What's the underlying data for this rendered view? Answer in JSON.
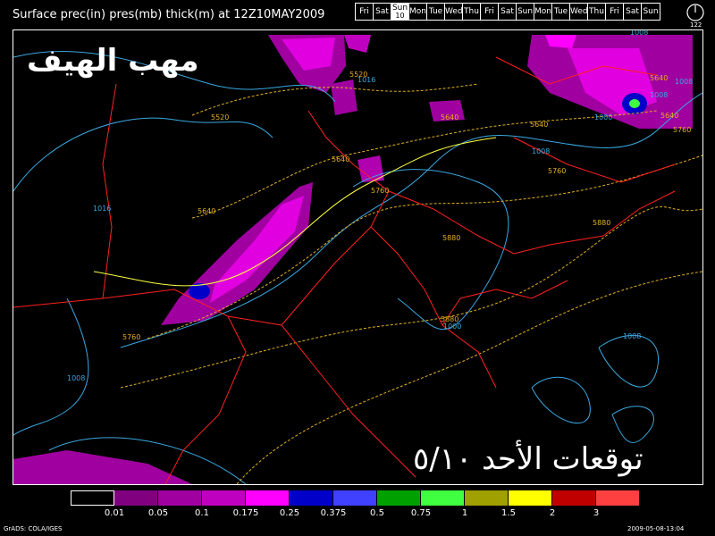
{
  "header": {
    "title": "Surface prec(in) pres(mb) thick(m) at 12Z10MAY2009"
  },
  "daybar": {
    "days": [
      "Fri",
      "Sat",
      "Sun",
      "Mon",
      "Tue",
      "Wed",
      "Thu",
      "Fri",
      "Sat",
      "Sun",
      "Mon",
      "Tue",
      "Wed",
      "Thu",
      "Fri",
      "Sat",
      "Sun"
    ],
    "selected_index": 2,
    "selected_sub": "10",
    "clock_label": "122"
  },
  "overlay": {
    "top_text": "مهب الهيف",
    "bottom_text": "توقعات الأحد ٥/١٠"
  },
  "contour_labels": {
    "thickness": [
      "5520",
      "5520",
      "5640",
      "5640",
      "5640",
      "5640",
      "5640",
      "5760",
      "5760",
      "5760",
      "5880",
      "5880",
      "5880",
      "5640",
      "5760"
    ],
    "pressure": [
      "1016",
      "1016",
      "1008",
      "1008",
      "1008",
      "1000",
      "1008",
      "1008",
      "1000",
      "1008"
    ]
  },
  "legend": {
    "colors": [
      "#000000",
      "#800080",
      "#a000a0",
      "#c000c0",
      "#ff00ff",
      "#0000c8",
      "#4040ff",
      "#00a000",
      "#40ff40",
      "#a0a000",
      "#ffff00",
      "#c00000",
      "#ff4040"
    ],
    "ticks": [
      "0.01",
      "0.05",
      "0.1",
      "0.175",
      "0.25",
      "0.375",
      "0.5",
      "0.75",
      "1",
      "1.5",
      "2",
      "3"
    ]
  },
  "footer": {
    "left": "GrADS: COLA/IGES",
    "right": "2009-05-08-13:04"
  }
}
